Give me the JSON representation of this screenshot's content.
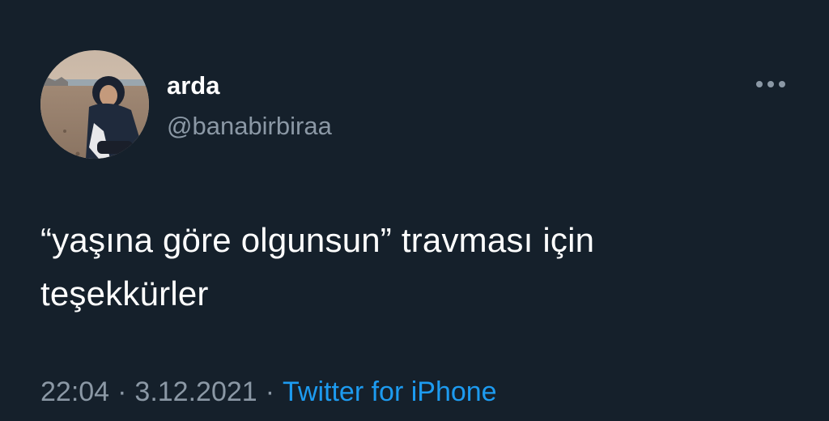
{
  "tweet": {
    "author": {
      "display_name": "arda",
      "handle": "@banabirbiraa",
      "avatar": "profile-photo"
    },
    "more_icon": "more-horizontal-icon",
    "text_line1": "“yaşına göre olgunsun” travması için",
    "text_line2": "teşekkürler",
    "time": "22:04",
    "separator": "·",
    "date": "3.12.2021",
    "source": "Twitter for iPhone"
  },
  "colors": {
    "background": "#15202b",
    "primary_text": "#ffffff",
    "secondary_text": "#8b98a5",
    "accent": "#1d9bf0"
  }
}
